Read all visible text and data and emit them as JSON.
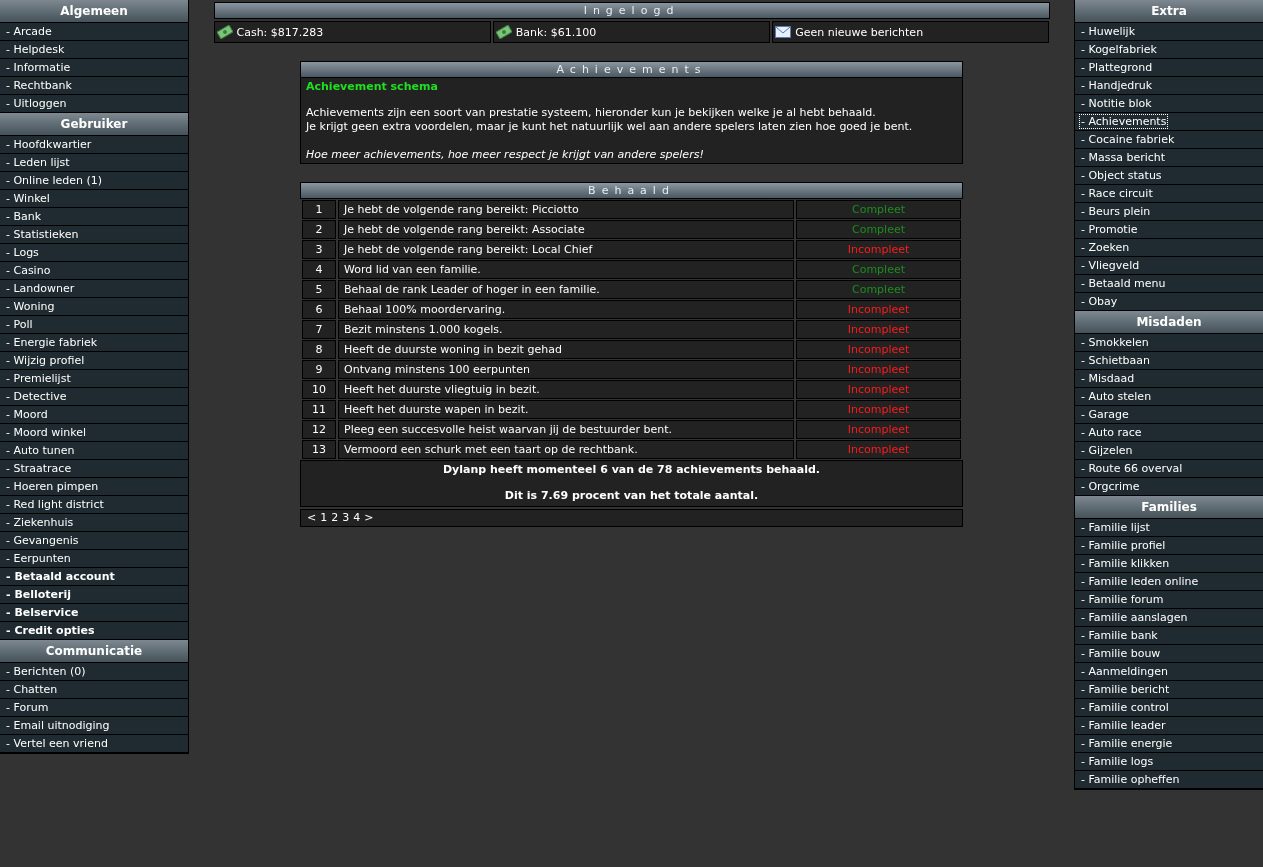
{
  "left_menu": [
    {
      "title": "Algemeen",
      "items": [
        {
          "label": "- Arcade",
          "bold": false,
          "selected": false
        },
        {
          "label": "- Helpdesk",
          "bold": false,
          "selected": false
        },
        {
          "label": "- Informatie",
          "bold": false,
          "selected": false
        },
        {
          "label": "- Rechtbank",
          "bold": false,
          "selected": false
        },
        {
          "label": "- Uitloggen",
          "bold": false,
          "selected": false
        }
      ]
    },
    {
      "title": "Gebruiker",
      "items": [
        {
          "label": "- Hoofdkwartier",
          "bold": false,
          "selected": false
        },
        {
          "label": "- Leden lijst",
          "bold": false,
          "selected": false
        },
        {
          "label": "- Online leden (1)",
          "bold": false,
          "selected": false
        },
        {
          "label": "- Winkel",
          "bold": false,
          "selected": false
        },
        {
          "label": "- Bank",
          "bold": false,
          "selected": false
        },
        {
          "label": "- Statistieken",
          "bold": false,
          "selected": false
        },
        {
          "label": "- Logs",
          "bold": false,
          "selected": false
        },
        {
          "label": "- Casino",
          "bold": false,
          "selected": false
        },
        {
          "label": "- Landowner",
          "bold": false,
          "selected": false
        },
        {
          "label": "- Woning",
          "bold": false,
          "selected": false
        },
        {
          "label": "- Poll",
          "bold": false,
          "selected": false
        },
        {
          "label": "- Energie fabriek",
          "bold": false,
          "selected": false
        },
        {
          "label": "- Wijzig profiel",
          "bold": false,
          "selected": false
        },
        {
          "label": "- Premielijst",
          "bold": false,
          "selected": false
        },
        {
          "label": "- Detective",
          "bold": false,
          "selected": false
        },
        {
          "label": "- Moord",
          "bold": false,
          "selected": false
        },
        {
          "label": "- Moord winkel",
          "bold": false,
          "selected": false
        },
        {
          "label": "- Auto tunen",
          "bold": false,
          "selected": false
        },
        {
          "label": "- Straatrace",
          "bold": false,
          "selected": false
        },
        {
          "label": "- Hoeren pimpen",
          "bold": false,
          "selected": false
        },
        {
          "label": "- Red light district",
          "bold": false,
          "selected": false
        },
        {
          "label": "- Ziekenhuis",
          "bold": false,
          "selected": false
        },
        {
          "label": "- Gevangenis",
          "bold": false,
          "selected": false
        },
        {
          "label": "- Eerpunten",
          "bold": false,
          "selected": false
        },
        {
          "label": "- Betaald account",
          "bold": true,
          "selected": false
        },
        {
          "label": "- Belloterij",
          "bold": true,
          "selected": false
        },
        {
          "label": "- Belservice",
          "bold": true,
          "selected": false
        },
        {
          "label": "- Credit opties",
          "bold": true,
          "selected": false
        }
      ]
    },
    {
      "title": "Communicatie",
      "items": [
        {
          "label": "- Berichten (0)",
          "bold": false,
          "selected": false
        },
        {
          "label": "- Chatten",
          "bold": false,
          "selected": false
        },
        {
          "label": "- Forum",
          "bold": false,
          "selected": false
        },
        {
          "label": "- Email uitnodiging",
          "bold": false,
          "selected": false
        },
        {
          "label": "- Vertel een vriend",
          "bold": false,
          "selected": false
        }
      ]
    }
  ],
  "header": {
    "title": "Ingelogd",
    "stats": [
      {
        "kind": "money",
        "text": "Cash: $817.283"
      },
      {
        "kind": "money",
        "text": "Bank: $61.100"
      },
      {
        "kind": "mail",
        "text": "Geen nieuwe berichten"
      }
    ]
  },
  "intro": {
    "title": "Achievements",
    "heading": "Achievement schema",
    "lines": [
      "Achievements zijn een soort van prestatie systeem, hieronder kun je bekijken welke je al hebt behaald.",
      "Je krijgt geen extra voordelen, maar je kunt het natuurlijk wel aan andere spelers laten zien hoe goed je bent."
    ],
    "note": "Hoe meer achievements, hoe meer respect je krijgt van andere spelers!"
  },
  "achieved": {
    "title": "Behaald",
    "rows": [
      {
        "number": "1",
        "text": "Je hebt de volgende rang bereikt: Picciotto",
        "status": "Compleet",
        "done": true
      },
      {
        "number": "2",
        "text": "Je hebt de volgende rang bereikt: Associate",
        "status": "Compleet",
        "done": true
      },
      {
        "number": "3",
        "text": "Je hebt de volgende rang bereikt: Local Chief",
        "status": "Incompleet",
        "done": false
      },
      {
        "number": "4",
        "text": "Word lid van een familie.",
        "status": "Compleet",
        "done": true
      },
      {
        "number": "5",
        "text": "Behaal de rank Leader of hoger in een familie.",
        "status": "Compleet",
        "done": true
      },
      {
        "number": "6",
        "text": "Behaal 100% moordervaring.",
        "status": "Incompleet",
        "done": false
      },
      {
        "number": "7",
        "text": "Bezit minstens 1.000 kogels.",
        "status": "Incompleet",
        "done": false
      },
      {
        "number": "8",
        "text": "Heeft de duurste woning in bezit gehad",
        "status": "Incompleet",
        "done": false
      },
      {
        "number": "9",
        "text": "Ontvang minstens 100 eerpunten",
        "status": "Incompleet",
        "done": false
      },
      {
        "number": "10",
        "text": "Heeft het duurste vliegtuig in bezit.",
        "status": "Incompleet",
        "done": false
      },
      {
        "number": "11",
        "text": "Heeft het duurste wapen in bezit.",
        "status": "Incompleet",
        "done": false
      },
      {
        "number": "12",
        "text": "Pleeg een succesvolle heist waarvan jij de bestuurder bent.",
        "status": "Incompleet",
        "done": false
      },
      {
        "number": "13",
        "text": "Vermoord een schurk met een taart op de rechtbank.",
        "status": "Incompleet",
        "done": false
      }
    ],
    "summary": [
      "Dylanp heeft momenteel 6 van de 78 achievements behaald.",
      "Dit is 7.69 procent van het totale aantal."
    ],
    "pagination": [
      "<",
      "1",
      "2",
      "3",
      "4",
      ">"
    ]
  },
  "right_menu": [
    {
      "title": "Extra",
      "items": [
        {
          "label": "- Huwelijk",
          "bold": false,
          "selected": false
        },
        {
          "label": "- Kogelfabriek",
          "bold": false,
          "selected": false
        },
        {
          "label": "- Plattegrond",
          "bold": false,
          "selected": false
        },
        {
          "label": "- Handjedruk",
          "bold": false,
          "selected": false
        },
        {
          "label": "- Notitie blok",
          "bold": false,
          "selected": false
        },
        {
          "label": "- Achievements",
          "bold": false,
          "selected": true
        },
        {
          "label": "- Cocaine fabriek",
          "bold": false,
          "selected": false
        },
        {
          "label": "- Massa bericht",
          "bold": false,
          "selected": false
        },
        {
          "label": "- Object status",
          "bold": false,
          "selected": false
        },
        {
          "label": "- Race circuit",
          "bold": false,
          "selected": false
        },
        {
          "label": "- Beurs plein",
          "bold": false,
          "selected": false
        },
        {
          "label": "- Promotie",
          "bold": false,
          "selected": false
        },
        {
          "label": "- Zoeken",
          "bold": false,
          "selected": false
        },
        {
          "label": "- Vliegveld",
          "bold": false,
          "selected": false
        },
        {
          "label": "- Betaald menu",
          "bold": false,
          "selected": false
        },
        {
          "label": "- Obay",
          "bold": false,
          "selected": false
        }
      ]
    },
    {
      "title": "Misdaden",
      "items": [
        {
          "label": "- Smokkelen",
          "bold": false,
          "selected": false
        },
        {
          "label": "- Schietbaan",
          "bold": false,
          "selected": false
        },
        {
          "label": "- Misdaad",
          "bold": false,
          "selected": false
        },
        {
          "label": "- Auto stelen",
          "bold": false,
          "selected": false
        },
        {
          "label": "- Garage",
          "bold": false,
          "selected": false
        },
        {
          "label": "- Auto race",
          "bold": false,
          "selected": false
        },
        {
          "label": "- Gijzelen",
          "bold": false,
          "selected": false
        },
        {
          "label": "- Route 66 overval",
          "bold": false,
          "selected": false
        },
        {
          "label": "- Orgcrime",
          "bold": false,
          "selected": false
        }
      ]
    },
    {
      "title": "Families",
      "items": [
        {
          "label": "- Familie lijst",
          "bold": false,
          "selected": false
        },
        {
          "label": "- Familie profiel",
          "bold": false,
          "selected": false
        },
        {
          "label": "- Familie klikken",
          "bold": false,
          "selected": false
        },
        {
          "label": "- Familie leden online",
          "bold": false,
          "selected": false
        },
        {
          "label": "- Familie forum",
          "bold": false,
          "selected": false
        },
        {
          "label": "- Familie aanslagen",
          "bold": false,
          "selected": false
        },
        {
          "label": "- Familie bank",
          "bold": false,
          "selected": false
        },
        {
          "label": "- Familie bouw",
          "bold": false,
          "selected": false
        },
        {
          "label": "- Aanmeldingen",
          "bold": false,
          "selected": false
        },
        {
          "label": "- Familie bericht",
          "bold": false,
          "selected": false
        },
        {
          "label": "- Familie control",
          "bold": false,
          "selected": false
        },
        {
          "label": "- Familie leader",
          "bold": false,
          "selected": false
        },
        {
          "label": "- Familie energie",
          "bold": false,
          "selected": false
        },
        {
          "label": "- Familie logs",
          "bold": false,
          "selected": false
        },
        {
          "label": "- Familie opheffen",
          "bold": false,
          "selected": false
        }
      ]
    }
  ]
}
